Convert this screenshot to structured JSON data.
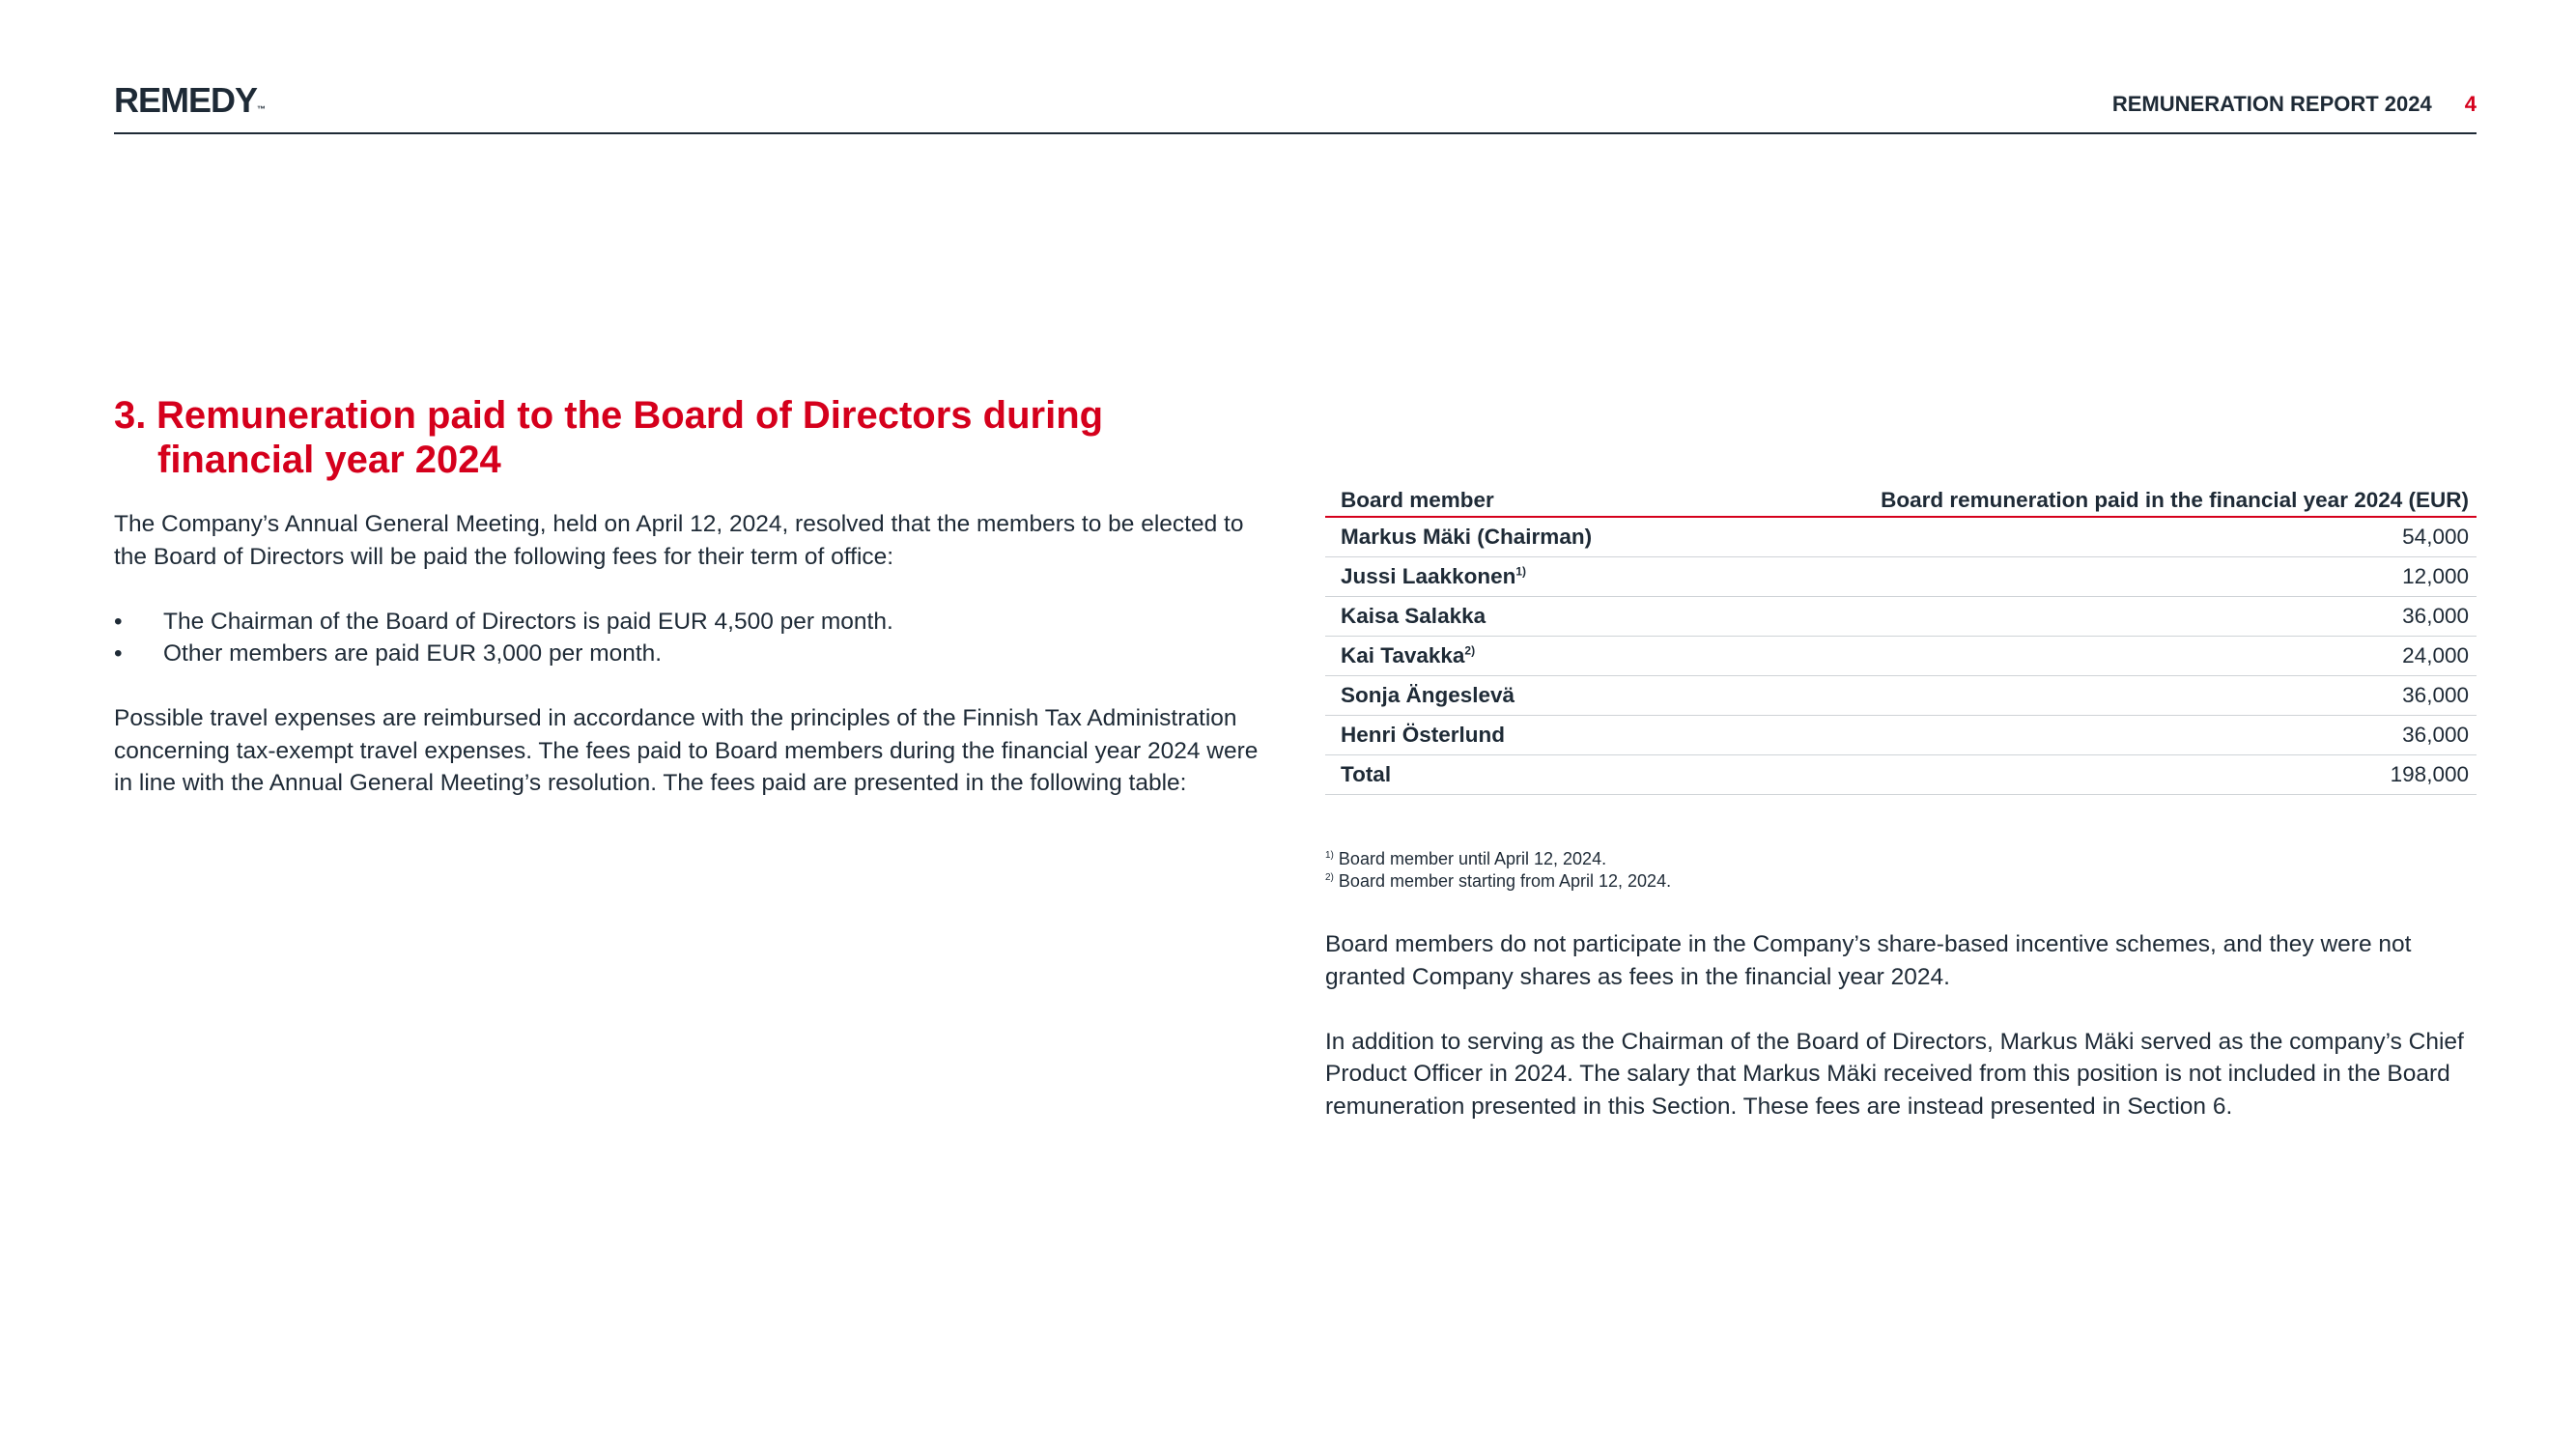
{
  "header": {
    "logo_text": "REMEDY",
    "logo_mark": "™",
    "report_title": "REMUNERATION REPORT 2024",
    "page_number": "4"
  },
  "section": {
    "number": "3.",
    "title_line1": "Remuneration paid to the Board of Directors during",
    "title_line2": "financial year 2024",
    "intro": "The Company’s Annual General Meeting, held on April 12, 2024, resolved that the members to be elected to the Board of Directors will be paid the following fees for their term of office:",
    "bullets": [
      "The Chairman of the Board of Directors is paid EUR 4,500 per month.",
      "Other members are paid EUR 3,000 per month."
    ],
    "travel_paragraph": "Possible travel expenses are reimbursed in accordance with the principles of the Finnish Tax Administration concerning tax-exempt travel expenses. The fees paid to Board members during the financial year 2024 were in line with the Annual General Meeting’s resolution. The fees paid are presented in the following table:"
  },
  "table": {
    "headers": [
      "Board member",
      "Board remuneration paid in the financial year 2024 (EUR)"
    ],
    "rows": [
      {
        "name": "Markus Mäki (Chairman)",
        "note": "",
        "value": "54,000"
      },
      {
        "name": "Jussi Laakkonen",
        "note": "1)",
        "value": "12,000"
      },
      {
        "name": "Kaisa Salakka",
        "note": "",
        "value": "36,000"
      },
      {
        "name": "Kai Tavakka",
        "note": "2)",
        "value": "24,000"
      },
      {
        "name": "Sonja Ängeslevä",
        "note": "",
        "value": "36,000"
      },
      {
        "name": "Henri Österlund",
        "note": "",
        "value": "36,000"
      },
      {
        "name": "Total",
        "note": "",
        "value": "198,000"
      }
    ]
  },
  "footnotes": [
    {
      "mark": "1)",
      "text": "Board member until April 12, 2024."
    },
    {
      "mark": "2)",
      "text": "Board member starting from April 12, 2024."
    }
  ],
  "right_paragraphs": [
    "Board members do not participate in the Company’s share-based incentive schemes, and they were not granted Company shares as fees in the financial year 2024.",
    "In addition to serving as the Chairman of the Board of Directors, Markus Mäki served as the company’s Chief Product Officer in 2024. The salary that Markus Mäki received from this position is not included in the Board remuneration presented in this Section. These fees are instead presented in Section 6."
  ],
  "colors": {
    "accent_red": "#d5001c",
    "text_dark": "#1e2a36",
    "row_rule": "#cfd3d7"
  }
}
